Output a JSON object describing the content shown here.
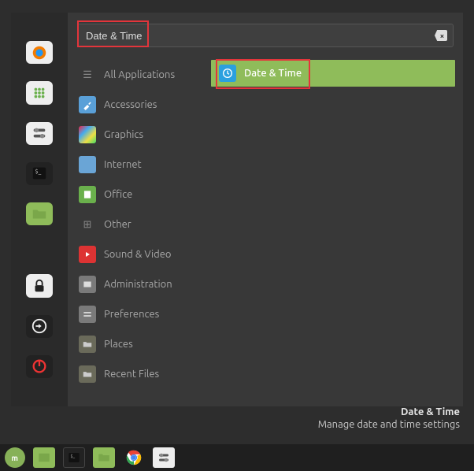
{
  "search": {
    "value": "Date & Time",
    "clear_icon": "⌫"
  },
  "categories": [
    {
      "label": "All Applications",
      "icon": "all"
    },
    {
      "label": "Accessories",
      "icon": "acc"
    },
    {
      "label": "Graphics",
      "icon": "gra"
    },
    {
      "label": "Internet",
      "icon": "int"
    },
    {
      "label": "Office",
      "icon": "off"
    },
    {
      "label": "Other",
      "icon": "oth"
    },
    {
      "label": "Sound & Video",
      "icon": "sv"
    },
    {
      "label": "Administration",
      "icon": "adm"
    },
    {
      "label": "Preferences",
      "icon": "pref"
    },
    {
      "label": "Places",
      "icon": "pla"
    },
    {
      "label": "Recent Files",
      "icon": "rec"
    }
  ],
  "results": [
    {
      "label": "Date & Time",
      "icon": "clock"
    }
  ],
  "tooltip": {
    "title": "Date & Time",
    "desc": "Manage date and time settings"
  },
  "favorites": [
    "firefox",
    "apps",
    "disks",
    "terminal",
    "files",
    "lock",
    "logout",
    "power"
  ],
  "taskbar": [
    "mint-menu",
    "file-manager",
    "terminal",
    "files",
    "chrome",
    "disks"
  ],
  "highlights": [
    "search-box",
    "result-date-time"
  ]
}
